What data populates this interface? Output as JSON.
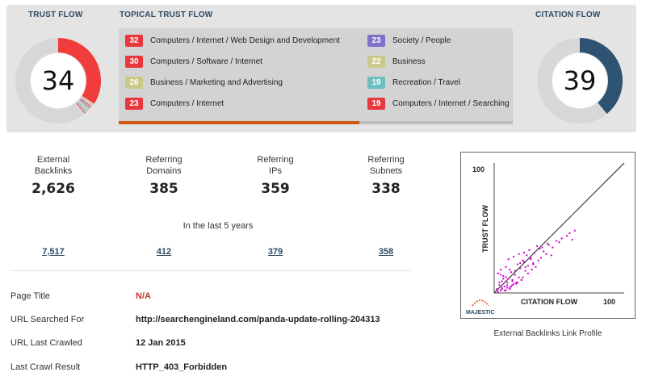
{
  "trust_flow": {
    "title": "TRUST FLOW",
    "value": 34,
    "color": "#f03c3c"
  },
  "topical_trust_flow": {
    "title": "TOPICAL TRUST FLOW",
    "progress": 0.61,
    "topics": [
      {
        "score": "32",
        "label": "Computers / Internet / Web Design and Development",
        "color": "#e8383d"
      },
      {
        "score": "30",
        "label": "Computers / Software / Internet",
        "color": "#e8383d"
      },
      {
        "score": "26",
        "label": "Business / Marketing and Advertising",
        "color": "#c9c98a"
      },
      {
        "score": "23",
        "label": "Computers / Internet",
        "color": "#e8383d"
      },
      {
        "score": "23",
        "label": "Society / People",
        "color": "#7d71c9"
      },
      {
        "score": "22",
        "label": "Business",
        "color": "#c9c98a"
      },
      {
        "score": "19",
        "label": "Recreation / Travel",
        "color": "#6dbfc0"
      },
      {
        "score": "19",
        "label": "Computers / Internet / Searching",
        "color": "#e8383d"
      }
    ]
  },
  "citation_flow": {
    "title": "CITATION FLOW",
    "value": 39,
    "color": "#2d5272"
  },
  "metrics": [
    {
      "label_line1": "External",
      "label_line2": "Backlinks",
      "value": "2,626",
      "history": "7,517"
    },
    {
      "label_line1": "Referring",
      "label_line2": "Domains",
      "value": "385",
      "history": "412"
    },
    {
      "label_line1": "Referring",
      "label_line2": "IPs",
      "value": "359",
      "history": "379"
    },
    {
      "label_line1": "Referring",
      "label_line2": "Subnets",
      "value": "338",
      "history": "358"
    }
  ],
  "history_period": "In the last 5 years",
  "info": {
    "page_title_label": "Page Title",
    "page_title_value": "N/A",
    "url_searched_label": "URL Searched For",
    "url_searched_value": "http://searchengineland.com/panda-update-rolling-204313",
    "url_crawled_label": "URL Last Crawled",
    "url_crawled_value": "12 Jan 2015",
    "crawl_result_label": "Last Crawl Result",
    "crawl_result_value": "HTTP_403_Forbidden"
  },
  "chart_data": {
    "type": "scatter",
    "xlabel": "CITATION FLOW",
    "ylabel": "TRUST FLOW",
    "x_max_label": "100",
    "y_max_label": "100",
    "xlim": [
      0,
      100
    ],
    "ylim": [
      0,
      100
    ],
    "point_color": "#cc00cc",
    "diagonal": true,
    "logo_text": "MAJESTIC",
    "caption": "External Backlinks Link Profile",
    "x": [
      2,
      4,
      5,
      6,
      8,
      9,
      10,
      12,
      14,
      15,
      3,
      5,
      7,
      9,
      11,
      13,
      16,
      18,
      20,
      22,
      24,
      6,
      8,
      10,
      12,
      14,
      17,
      19,
      21,
      23,
      26,
      28,
      30,
      4,
      7,
      11,
      15,
      19,
      25,
      27,
      31,
      33,
      35,
      38,
      41,
      45,
      48,
      52,
      56,
      60,
      9,
      13,
      17,
      21,
      29,
      32,
      36,
      40,
      44,
      3,
      6,
      10,
      14,
      18,
      22,
      26,
      30,
      34,
      5,
      12,
      20,
      24,
      28,
      16,
      23,
      37,
      42,
      50,
      58,
      62
    ],
    "y": [
      3,
      6,
      2,
      9,
      5,
      12,
      8,
      4,
      10,
      7,
      15,
      18,
      13,
      20,
      11,
      16,
      14,
      22,
      19,
      25,
      17,
      4,
      2,
      6,
      3,
      9,
      8,
      12,
      10,
      24,
      21,
      27,
      23,
      8,
      11,
      26,
      28,
      30,
      29,
      33,
      31,
      36,
      34,
      32,
      38,
      35,
      40,
      42,
      44,
      41,
      2,
      5,
      7,
      10,
      18,
      20,
      27,
      30,
      29,
      1,
      3,
      4,
      6,
      8,
      12,
      15,
      22,
      25,
      14,
      18,
      23,
      20,
      26,
      17,
      31,
      35,
      37,
      39,
      46,
      48
    ]
  }
}
